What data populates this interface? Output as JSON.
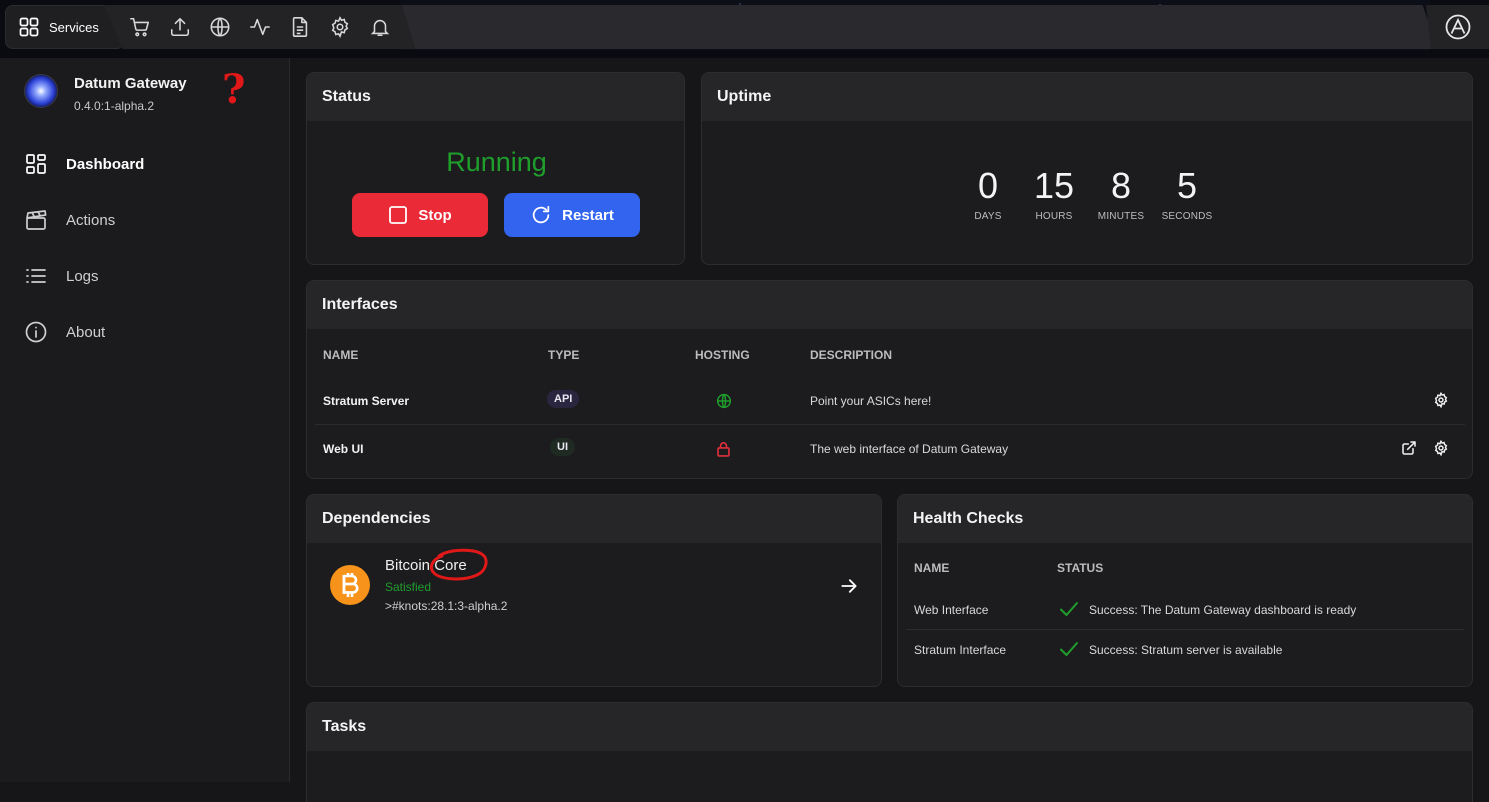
{
  "topbar": {
    "services_label": "Services",
    "icons": [
      "cart-icon",
      "upload-icon",
      "globe-icon",
      "activity-icon",
      "document-icon",
      "gear-icon",
      "bell-icon"
    ]
  },
  "service": {
    "name": "Datum Gateway",
    "version": "0.4.0:1-alpha.2",
    "annotation": "?"
  },
  "nav": [
    {
      "label": "Dashboard",
      "active": true
    },
    {
      "label": "Actions"
    },
    {
      "label": "Logs"
    },
    {
      "label": "About"
    }
  ],
  "status": {
    "title": "Status",
    "state": "Running",
    "stop_label": "Stop",
    "restart_label": "Restart"
  },
  "uptime": {
    "title": "Uptime",
    "units": [
      {
        "value": "0",
        "label": "DAYS"
      },
      {
        "value": "15",
        "label": "HOURS"
      },
      {
        "value": "8",
        "label": "MINUTES"
      },
      {
        "value": "5",
        "label": "SECONDS"
      }
    ]
  },
  "interfaces": {
    "title": "Interfaces",
    "headers": {
      "name": "NAME",
      "type": "TYPE",
      "hosting": "HOSTING",
      "description": "DESCRIPTION"
    },
    "rows": [
      {
        "name": "Stratum Server",
        "type": "API",
        "description": "Point your ASICs here!"
      },
      {
        "name": "Web UI",
        "type": "UI",
        "description": "The web interface of Datum Gateway"
      }
    ]
  },
  "dependencies": {
    "title": "Dependencies",
    "item": {
      "name": "Bitcoin Core",
      "status": "Satisfied",
      "version": ">#knots:28.1:3-alpha.2"
    }
  },
  "health": {
    "title": "Health Checks",
    "headers": {
      "name": "NAME",
      "status": "STATUS"
    },
    "rows": [
      {
        "name": "Web Interface",
        "status": "Success: The Datum Gateway dashboard is ready"
      },
      {
        "name": "Stratum Interface",
        "status": "Success: Stratum server is available"
      }
    ]
  },
  "tasks": {
    "title": "Tasks"
  },
  "colors": {
    "running": "#1f9e2c",
    "stop": "#ea2a36",
    "restart": "#3264f0",
    "success": "#1f9e2c",
    "bitcoin": "#f7931a",
    "annotation": "#e01818"
  }
}
